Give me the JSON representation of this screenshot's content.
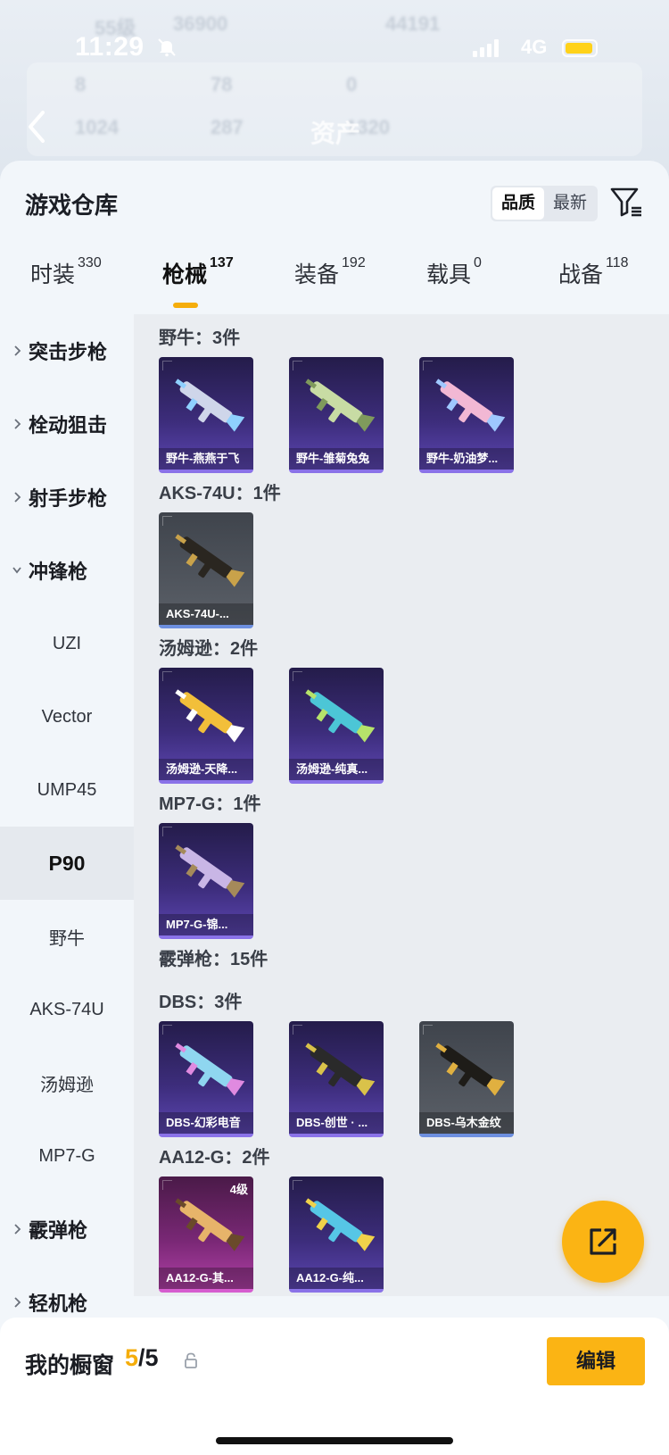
{
  "status_bar": {
    "time": "11:29",
    "network": "4G"
  },
  "background": {
    "title": "资产",
    "ghost_texts": [
      "55级",
      "36900",
      "44191",
      "8",
      "78",
      "0",
      "1024",
      "287",
      "1320"
    ]
  },
  "sheet": {
    "title": "游戏仓库",
    "sort_options": [
      {
        "label": "品质",
        "active": true
      },
      {
        "label": "最新",
        "active": false
      }
    ],
    "tabs": [
      {
        "label": "时装",
        "count": "330"
      },
      {
        "label": "枪械",
        "count": "137",
        "active": true
      },
      {
        "label": "装备",
        "count": "192"
      },
      {
        "label": "载具",
        "count": "0"
      },
      {
        "label": "战备",
        "count": "118"
      }
    ]
  },
  "categories": [
    {
      "label": "突击步枪",
      "type": "parent",
      "expanded": false
    },
    {
      "label": "栓动狙击",
      "type": "parent",
      "expanded": false
    },
    {
      "label": "射手步枪",
      "type": "parent",
      "expanded": false
    },
    {
      "label": "冲锋枪",
      "type": "parent",
      "expanded": true
    },
    {
      "label": "UZI",
      "type": "child"
    },
    {
      "label": "Vector",
      "type": "child"
    },
    {
      "label": "UMP45",
      "type": "child"
    },
    {
      "label": "P90",
      "type": "child",
      "selected": true
    },
    {
      "label": "野牛",
      "type": "child"
    },
    {
      "label": "AKS-74U",
      "type": "child"
    },
    {
      "label": "汤姆逊",
      "type": "child"
    },
    {
      "label": "MP7-G",
      "type": "child"
    },
    {
      "label": "霰弹枪",
      "type": "parent",
      "expanded": false
    },
    {
      "label": "轻机枪",
      "type": "parent",
      "expanded": false
    }
  ],
  "groups": [
    {
      "title": "野牛：3件",
      "items": [
        {
          "name": "野牛-燕燕于飞",
          "rarity": "purple",
          "gun_color": "#cfd6ea",
          "accent": "#8fd0ff"
        },
        {
          "name": "野牛-雏菊兔兔",
          "rarity": "purple",
          "gun_color": "#c8dca4",
          "accent": "#7f9a5c"
        },
        {
          "name": "野牛-奶油梦...",
          "rarity": "purple",
          "gun_color": "#f2b8d4",
          "accent": "#9fc8ff"
        }
      ]
    },
    {
      "title": "AKS-74U：1件",
      "items": [
        {
          "name": "AKS-74U-...",
          "rarity": "gray",
          "gun_color": "#2a2620",
          "accent": "#c9a24a"
        }
      ]
    },
    {
      "title": "汤姆逊：2件",
      "items": [
        {
          "name": "汤姆逊-天降...",
          "rarity": "purple",
          "gun_color": "#f2bf3a",
          "accent": "#ffffff"
        },
        {
          "name": "汤姆逊-纯真...",
          "rarity": "purple",
          "gun_color": "#4cc6d6",
          "accent": "#b6e36a"
        }
      ]
    },
    {
      "title": "MP7-G：1件",
      "items": [
        {
          "name": "MP7-G-锦...",
          "rarity": "purple",
          "gun_color": "#c9b6e6",
          "accent": "#a58a5a"
        }
      ]
    },
    {
      "title": "霰弹枪：15件",
      "items": []
    },
    {
      "title": "DBS：3件",
      "items": [
        {
          "name": "DBS-幻彩电音",
          "rarity": "purple",
          "gun_color": "#8fd6f0",
          "accent": "#e08ae0"
        },
        {
          "name": "DBS-创世 · ...",
          "rarity": "purple",
          "gun_color": "#2a2a2a",
          "accent": "#d9c24a"
        },
        {
          "name": "DBS-乌木金纹",
          "rarity": "gray",
          "gun_color": "#1e1c18",
          "accent": "#e0b040"
        }
      ]
    },
    {
      "title": "AA12-G：2件",
      "items": [
        {
          "name": "AA12-G-其...",
          "rarity": "pink",
          "gun_color": "#e7b46a",
          "accent": "#6a4a2a",
          "level": "4级"
        },
        {
          "name": "AA12-G-纯...",
          "rarity": "purple",
          "gun_color": "#56c6e6",
          "accent": "#f0d24a"
        }
      ]
    }
  ],
  "bottom_bar": {
    "label": "我的橱窗",
    "current": "5",
    "total": "/5",
    "edit_label": "编辑"
  },
  "colors": {
    "accent": "#fbb414",
    "purple_card": "#3d2d7c",
    "gray_card": "#52575f",
    "pink_card": "#7a2876"
  },
  "icons": [
    "bell-mute-icon",
    "back-chevron-icon",
    "filter-icon",
    "chevron-right-icon",
    "chevron-down-icon",
    "share-external-icon",
    "lock-icon"
  ]
}
